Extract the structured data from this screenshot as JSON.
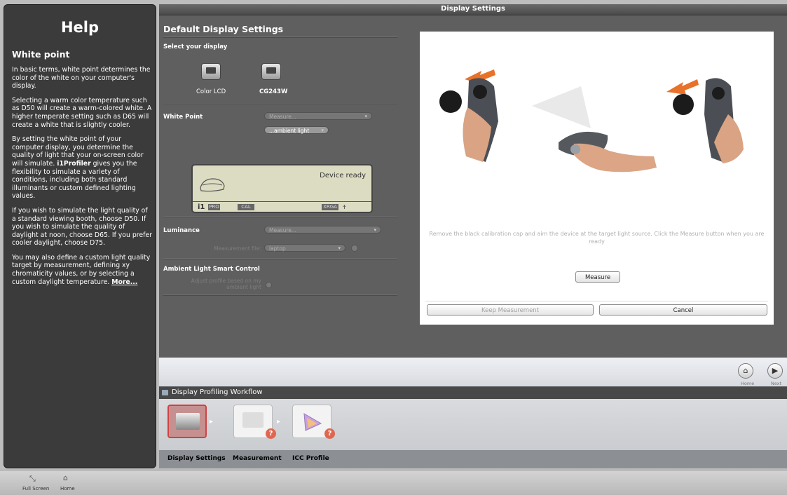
{
  "help": {
    "title": "Help",
    "topic": "White point",
    "p1": "In basic terms, white point determines the color of the white on your computer's display.",
    "p2": "Selecting a warm color temperature such as D50 will create a warm-colored white. A higher temperate setting such as D65 will create a white that is slightly cooler.",
    "p3_a": "By setting the white point of your computer display, you determine the quality of light that your on-screen color will simulate. ",
    "p3_b": "i1Profiler",
    "p3_c": " gives you the flexibility to simulate a variety of conditions, including both standard illuminants or custom defined lighting values.",
    "p4": "If you wish to simulate the light quality of a standard viewing booth, choose D50. If you wish to simulate the quality of daylight at noon, choose D65. If you prefer cooler daylight, choose D75.",
    "p5": "You may also define a custom light quality target by measurement, defining xy chromaticity values, or by selecting a custom daylight temperature. ",
    "more": "More..."
  },
  "window": {
    "title": "Display Settings"
  },
  "settings": {
    "heading": "Default Display Settings",
    "select_display": "Select your display",
    "displays": [
      "Color LCD",
      "CG243W"
    ],
    "white_point": {
      "label": "White Point",
      "dropdown": "Measure...",
      "sub_dropdown": "...ambient light"
    },
    "device": {
      "status": "Device ready",
      "logo": "i1",
      "tags": [
        "PRO",
        "CAL",
        "XRGA"
      ]
    },
    "luminance": {
      "label": "Luminance",
      "dropdown": "Measure...",
      "file_label": "Measurement file:",
      "file_value": "laptop"
    },
    "ambient": {
      "label": "Ambient Light Smart Control",
      "option": "Adjust profile based on my ambient light"
    }
  },
  "dialog": {
    "instruction": "Remove the black calibration cap and aim the device at the target light source. Click the Measure button when you are ready",
    "measure": "Measure",
    "keep": "Keep Measurement",
    "cancel": "Cancel"
  },
  "nav": {
    "home": "Home",
    "next": "Next"
  },
  "workflow": {
    "title": "Display Profiling Workflow",
    "steps": [
      "Display Settings",
      "Measurement",
      "ICC Profile"
    ]
  },
  "bottom": {
    "fullscreen": "Full Screen",
    "home": "Home"
  }
}
